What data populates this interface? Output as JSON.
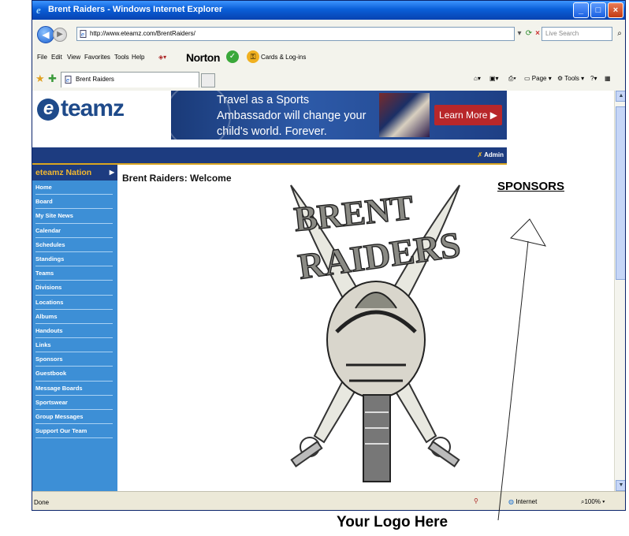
{
  "window": {
    "title": "Brent Raiders - Windows Internet Explorer",
    "controls": [
      "_",
      "□",
      "×"
    ]
  },
  "address": {
    "url": "http://www.eteamz.com/BrentRaiders/",
    "search_placeholder": "Live Search"
  },
  "menu": {
    "items": [
      "File",
      "Edit",
      "View",
      "Favorites",
      "Tools",
      "Help"
    ],
    "norton": "Norton",
    "cards": "Cards & Log-ins"
  },
  "tab": {
    "label": "Brent Raiders"
  },
  "toolbar_right": {
    "page": "Page",
    "tools": "Tools"
  },
  "site": {
    "logo": "teamz",
    "banner_text": "Travel as a Sports Ambassador will change your child's world. Forever.",
    "banner_button": "Learn More",
    "admin": "Admin",
    "nav_header": "eteamz Nation",
    "nav_items": [
      "Home",
      "Board",
      "My Site News",
      "Calendar",
      "Schedules",
      "Standings",
      "Teams",
      "Divisions",
      "Locations",
      "Albums",
      "Handouts",
      "Links",
      "Sponsors",
      "Guestbook",
      "Message Boards",
      "Sportswear",
      "Group Messages",
      "Support Our Team"
    ],
    "page_title": "Brent Raiders: Welcome",
    "crest_text": [
      "BRENT",
      "RAIDERS"
    ]
  },
  "status": {
    "text": "Done",
    "zone": "Internet",
    "zoom": "100%"
  },
  "annotations": {
    "sponsors": "SPONSORS",
    "logo_here": "Your Logo Here"
  },
  "colors": {
    "title_blue": "#0a5fd8",
    "site_navy": "#1d3c80",
    "nav_blue": "#3d8fd6",
    "nav_gold": "#f2b830",
    "banner_red": "#b8272a"
  }
}
